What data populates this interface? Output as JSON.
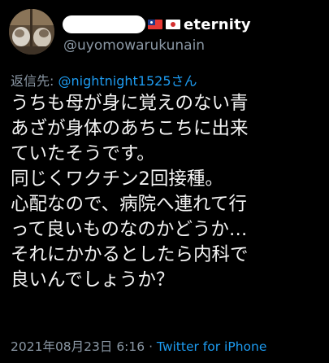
{
  "profile": {
    "display_name": "eternity",
    "handle": "@uyomowarukunain"
  },
  "reply": {
    "prefix": "返信先: ",
    "mention": "@nightnight1525さん"
  },
  "tweet": {
    "lines": [
      "うちも母が身に覚えのない青",
      "あざが身体のあちこちに出来",
      "ていたそうです。",
      "同じくワクチン2回接種。",
      "心配なので、病院へ連れて行",
      "って良いものなのかどうか…",
      "それにかかるとしたら内科で",
      "良いんでしょうか？"
    ]
  },
  "meta": {
    "timestamp": "2021年08月23日 6:16",
    "separator": " · ",
    "source": "Twitter for iPhone"
  }
}
